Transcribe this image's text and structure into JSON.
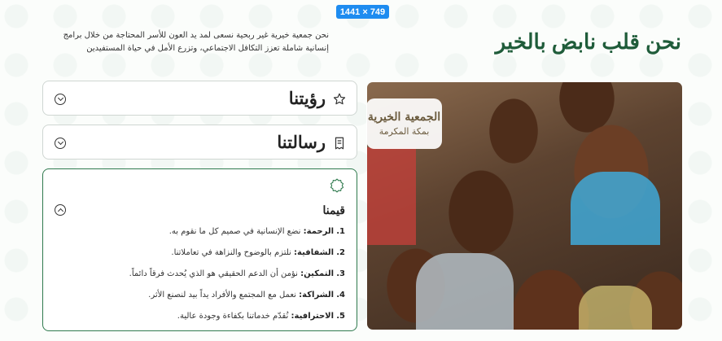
{
  "dimension_badge": "1441 × 749",
  "page_title": "نحن قلب نابض بالخير",
  "intro_text": "نحن جمعية خيرية غير ربحية نسعى لمد يد العون للأسر المحتاجة من خلال برامج إنسانية شاملة تعزز التكافل الاجتماعي، وتزرع الأمل  في حياة المستفيدين",
  "logo": {
    "main": "الجمعية الخيرية",
    "sub": "بمكة المكرمة"
  },
  "accordion": {
    "vision_label": "رؤيتنا",
    "mission_label": "رسالتنا",
    "values_label": "قيمنا",
    "values": [
      {
        "num": "1.",
        "title": "الرحمة:",
        "text": "نضع الإنسانية في صميم كل ما نقوم به."
      },
      {
        "num": "2.",
        "title": "الشفافية:",
        "text": "نلتزم بالوضوح والنزاهة في تعاملاتنا."
      },
      {
        "num": "3.",
        "title": "التمكين:",
        "text": "نؤمن أن الدعم الحقيقي هو الذي يُحدث فرقاً دائماً."
      },
      {
        "num": "4.",
        "title": "الشراكة:",
        "text": "نعمل مع المجتمع والأفراد يداً بيد لنصنع الأثر."
      },
      {
        "num": "5.",
        "title": "الاحترافية:",
        "text": "نُقدّم خدماتنا بكفاءة وجودة عالية."
      }
    ]
  },
  "icons": {
    "vision": "star-outline-icon",
    "mission": "document-icon",
    "values": "badge-star-icon",
    "collapsed": "chevron-down-circle-icon",
    "expanded": "chevron-up-circle-icon"
  },
  "colors": {
    "accent_green": "#1f5c3a",
    "active_border": "#2f7a4e",
    "badge_blue": "#1e8cf0"
  }
}
